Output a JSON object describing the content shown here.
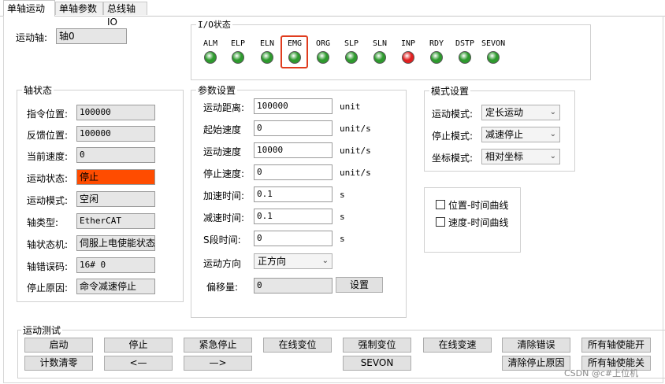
{
  "tabs": [
    "单轴运动",
    "单轴参数",
    "总线轴IO"
  ],
  "axis_select": {
    "label": "运动轴:",
    "value": "轴0"
  },
  "io_status": {
    "title": "I/O状态",
    "signals": [
      {
        "name": "ALM",
        "state": "on",
        "color": "#2e9a2e"
      },
      {
        "name": "ELP",
        "state": "on",
        "color": "#2e9a2e"
      },
      {
        "name": "ELN",
        "state": "on",
        "color": "#2e9a2e"
      },
      {
        "name": "EMG",
        "state": "on",
        "color": "#2e9a2e",
        "highlighted": true
      },
      {
        "name": "ORG",
        "state": "on",
        "color": "#2e9a2e"
      },
      {
        "name": "SLP",
        "state": "on",
        "color": "#2e9a2e"
      },
      {
        "name": "SLN",
        "state": "on",
        "color": "#2e9a2e"
      },
      {
        "name": "INP",
        "state": "alarm",
        "color": "#e02020"
      },
      {
        "name": "RDY",
        "state": "on",
        "color": "#2e9a2e"
      },
      {
        "name": "DSTP",
        "state": "on",
        "color": "#2e9a2e"
      },
      {
        "name": "SEVON",
        "state": "on",
        "color": "#2e9a2e"
      }
    ]
  },
  "axis_status": {
    "title": "轴状态",
    "fields": [
      {
        "label": "指令位置:",
        "value": "100000"
      },
      {
        "label": "反馈位置:",
        "value": "100000"
      },
      {
        "label": "当前速度:",
        "value": "0"
      },
      {
        "label": "运动状态:",
        "value": "停止",
        "highlight_color": "#ff4c00"
      },
      {
        "label": "运动模式:",
        "value": "空闲"
      },
      {
        "label": "轴类型:",
        "value": "EtherCAT"
      },
      {
        "label": "轴状态机:",
        "value": "伺服上电使能状态"
      },
      {
        "label": "轴错误码:",
        "value": "16# 0"
      },
      {
        "label": "停止原因:",
        "value": "命令减速停止"
      }
    ]
  },
  "params": {
    "title": "参数设置",
    "fields": [
      {
        "label": "运动距离:",
        "value": "100000",
        "unit": "unit"
      },
      {
        "label": "起始速度",
        "value": "0",
        "unit": "unit/s"
      },
      {
        "label": "运动速度",
        "value": "10000",
        "unit": "unit/s"
      },
      {
        "label": "停止速度:",
        "value": "0",
        "unit": "unit/s"
      },
      {
        "label": "加速时间:",
        "value": "0.1",
        "unit": "s"
      },
      {
        "label": "减速时间:",
        "value": "0.1",
        "unit": "s"
      },
      {
        "label": "S段时间:",
        "value": "0",
        "unit": "s"
      }
    ],
    "direction": {
      "label": "运动方向",
      "value": "正方向"
    },
    "offset": {
      "label": "偏移量:",
      "value": "0",
      "button": "设置"
    }
  },
  "mode_settings": {
    "title": "模式设置",
    "fields": [
      {
        "label": "运动模式:",
        "value": "定长运动"
      },
      {
        "label": "停止模式:",
        "value": "减速停止"
      },
      {
        "label": "坐标模式:",
        "value": "相对坐标"
      }
    ]
  },
  "curves": {
    "items": [
      {
        "label": "位置-时间曲线",
        "checked": false
      },
      {
        "label": "速度-时间曲线",
        "checked": false
      }
    ]
  },
  "motion_test": {
    "title": "运动测试",
    "row1": [
      "启动",
      "停止",
      "紧急停止",
      "在线变位",
      "强制变位",
      "在线变速",
      "清除错误",
      "所有轴使能开"
    ],
    "row2": [
      "计数清零",
      "<—",
      "—>",
      "SEVON",
      "清除停止原因",
      "所有轴使能关"
    ]
  },
  "watermark": "CSDN @c#上位机"
}
